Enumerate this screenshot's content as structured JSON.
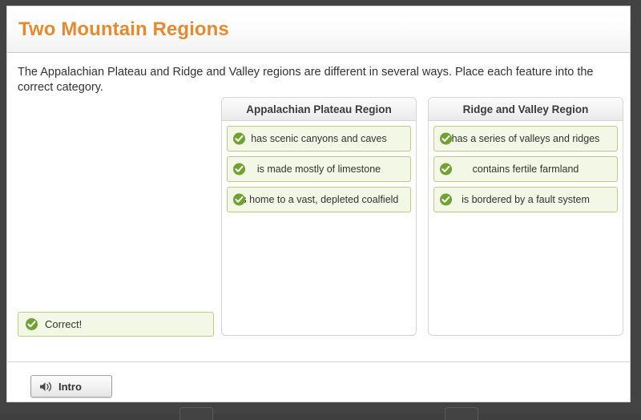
{
  "window": {
    "title": "Two Mountain Regions"
  },
  "main": {
    "instructions": "The Appalachian Plateau and Ridge and Valley regions are different in several ways. Place each feature into the correct category.",
    "categories": [
      {
        "header": "Appalachian Plateau Region",
        "items": [
          {
            "label": "has scenic canyons and caves",
            "icon": "check-circle-icon"
          },
          {
            "label": "is made mostly of limestone",
            "icon": "check-circle-icon"
          },
          {
            "label": "is home to a vast, depleted coalfield",
            "icon": "check-circle-icon"
          }
        ]
      },
      {
        "header": "Ridge and Valley Region",
        "items": [
          {
            "label": "has a series of valleys and ridges",
            "icon": "check-circle-icon"
          },
          {
            "label": "contains fertile farmland",
            "icon": "check-circle-icon"
          },
          {
            "label": "is bordered by a fault system",
            "icon": "check-circle-icon"
          }
        ]
      }
    ]
  },
  "feedback": {
    "message": "Correct!",
    "icon": "check-circle-icon"
  },
  "footer": {
    "intro_button": {
      "label": "Intro",
      "icon": "speaker-icon"
    }
  },
  "colors": {
    "title": "#e58a31",
    "success_border": "#b7cf84",
    "success_fill": "#f2f7e6",
    "check_green": "#6fa22e",
    "frame": "#434343"
  }
}
